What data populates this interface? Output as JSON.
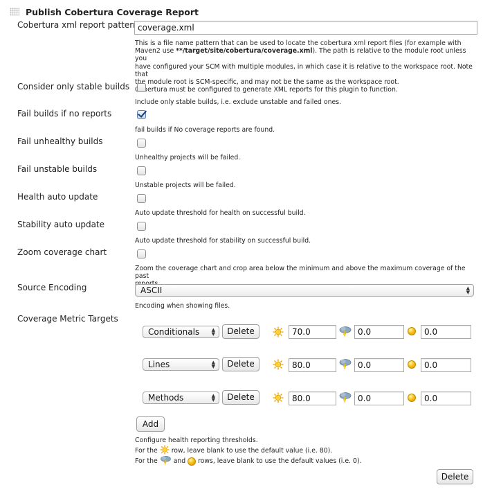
{
  "section_title": "Publish Cobertura Coverage Report",
  "xml_pattern": {
    "label": "Cobertura xml report pattern",
    "value": "coverage.xml",
    "help_line1": "This is a file name pattern that can be used to locate the cobertura xml report files (for example with",
    "help_line2_prefix": "Maven2 use ",
    "help_line2_bold": "**/target/site/cobertura/coverage.xml",
    "help_line2_suffix": "). The path is relative to the module root unless you",
    "help_line3": "have configured your SCM with multiple modules, in which case it is relative to the workspace root. Note that",
    "help_line4": "the module root is SCM-specific, and may not be the same as the workspace root.",
    "help_line5": "Cobertura must be configured to generate XML reports for this plugin to function."
  },
  "options": [
    {
      "label": "Consider only stable builds",
      "checked": false,
      "help": "Include only stable builds, i.e. exclude unstable and failed ones."
    },
    {
      "label": "Fail builds if no reports",
      "checked": true,
      "help": "fail builds if No coverage reports are found."
    },
    {
      "label": "Fail unhealthy builds",
      "checked": false,
      "help": "Unhealthy projects will be failed."
    },
    {
      "label": "Fail unstable builds",
      "checked": false,
      "help": "Unstable projects will be failed."
    },
    {
      "label": "Health auto update",
      "checked": false,
      "help": "Auto update threshold for health on successful build."
    },
    {
      "label": "Stability auto update",
      "checked": false,
      "help": "Auto update threshold for stability on successful build."
    },
    {
      "label": "Zoom coverage chart",
      "checked": false,
      "help_line1": "Zoom the coverage chart and crop area below the minimum and above the maximum coverage of the past",
      "help_line2": "reports."
    }
  ],
  "source_encoding": {
    "label": "Source Encoding",
    "value": "ASCII",
    "help": "Encoding when showing files."
  },
  "metric_targets": {
    "label": "Coverage Metric Targets",
    "delete_label": "Delete",
    "rows": [
      {
        "metric": "Conditionals",
        "healthy": "70.0",
        "unhealthy": "0.0",
        "unstable": "0.0"
      },
      {
        "metric": "Lines",
        "healthy": "80.0",
        "unhealthy": "0.0",
        "unstable": "0.0"
      },
      {
        "metric": "Methods",
        "healthy": "80.0",
        "unhealthy": "0.0",
        "unstable": "0.0"
      }
    ],
    "add_label": "Add",
    "help_line1": "Configure health reporting thresholds.",
    "help_line2_prefix": "For the",
    "help_line2_suffix": "row, leave blank to use the default value (i.e. 80).",
    "help_line3_prefix": "For the",
    "help_line3_and": "and",
    "help_line3_suffix": "rows, leave blank to use the default values (i.e. 0)."
  },
  "delete_section_label": "Delete",
  "icons": {
    "healthy": "sun-icon",
    "unhealthy": "storm-cloud-icon",
    "unstable": "yellow-ball-icon"
  }
}
